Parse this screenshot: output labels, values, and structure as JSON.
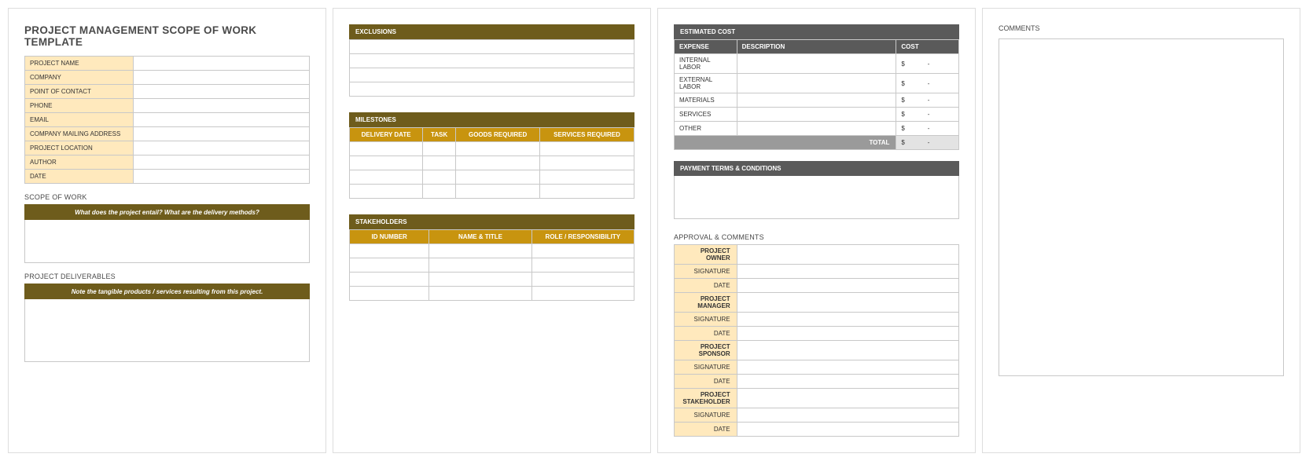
{
  "titles": {
    "main": "PROJECT MANAGEMENT SCOPE OF WORK TEMPLATE",
    "scope": "SCOPE OF WORK",
    "scope_hint": "What does the project entail? What are the delivery methods?",
    "deliverables": "PROJECT DELIVERABLES",
    "deliverables_hint": "Note the tangible products / services resulting from this project.",
    "exclusions": "EXCLUSIONS",
    "milestones": "MILESTONES",
    "stakeholders": "STAKEHOLDERS",
    "estimated_cost": "ESTIMATED COST",
    "payment": "PAYMENT TERMS & CONDITIONS",
    "approval": "APPROVAL & COMMENTS",
    "comments": "COMMENTS",
    "total": "TOTAL"
  },
  "info": {
    "project_name": "PROJECT NAME",
    "company": "COMPANY",
    "poc": "POINT OF CONTACT",
    "phone": "PHONE",
    "email": "EMAIL",
    "mailing": "COMPANY MAILING ADDRESS",
    "location": "PROJECT LOCATION",
    "author": "AUTHOR",
    "date": "DATE"
  },
  "milestones_headers": {
    "delivery_date": "DELIVERY DATE",
    "task": "TASK",
    "goods": "GOODS REQUIRED",
    "services": "SERVICES REQUIRED"
  },
  "stakeholders_headers": {
    "id": "ID NUMBER",
    "name": "NAME & TITLE",
    "role": "ROLE / RESPONSIBILITY"
  },
  "cost_headers": {
    "expense": "EXPENSE",
    "description": "DESCRIPTION",
    "cost": "COST"
  },
  "cost_rows": {
    "internal": "INTERNAL LABOR",
    "external": "EXTERNAL LABOR",
    "materials": "MATERIALS",
    "services": "SERVICES",
    "other": "OTHER"
  },
  "cost_values": {
    "internal": "$             -",
    "external": "$             -",
    "materials": "$             -",
    "services": "$             -",
    "other": "$             -",
    "total": "$             -"
  },
  "approval": {
    "project_owner": "PROJECT OWNER",
    "project_manager": "PROJECT MANAGER",
    "project_sponsor": "PROJECT SPONSOR",
    "project_stakeholder": "PROJECT STAKEHOLDER",
    "signature": "SIGNATURE",
    "date": "DATE"
  }
}
